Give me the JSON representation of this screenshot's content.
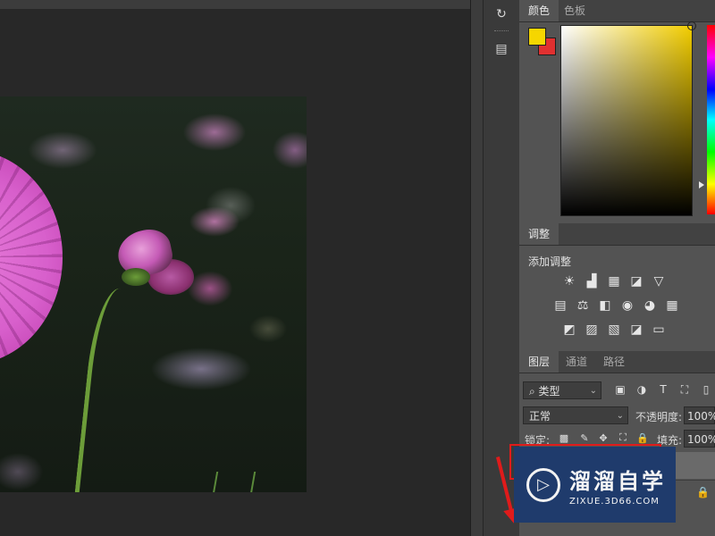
{
  "tools": {
    "history_icon": "history-icon",
    "properties_icon": "properties-icon"
  },
  "color_panel": {
    "tabs": [
      "颜色",
      "色板"
    ],
    "active_tab": 0,
    "foreground": "#f6d600",
    "background": "#e03030"
  },
  "adjustments": {
    "tab": "调整",
    "title": "添加调整",
    "icons_row1": [
      "☀",
      "▟",
      "▦",
      "◪",
      "▽"
    ],
    "icons_row2": [
      "▤",
      "⚖",
      "◧",
      "◉",
      "◕",
      "▦"
    ],
    "icons_row3": [
      "◩",
      "▨",
      "▧",
      "◪",
      "▭"
    ]
  },
  "layers": {
    "tabs": [
      "图层",
      "通道",
      "路径"
    ],
    "active_tab": 0,
    "filter_label": "类型",
    "blend_mode": "正常",
    "opacity_label": "不透明度:",
    "opacity_value": "100%",
    "lock_label": "锁定:",
    "fill_label": "填充:",
    "fill_value": "100%",
    "filter_icons": [
      "▣",
      "◑",
      "T",
      "⛶",
      "▯"
    ],
    "lock_icons": [
      "▩",
      "✎",
      "✥",
      "⛶",
      "🔒"
    ]
  },
  "watermark": {
    "brand_cn": "溜溜自学",
    "brand_en": "ZIXUE.3D66.COM"
  }
}
